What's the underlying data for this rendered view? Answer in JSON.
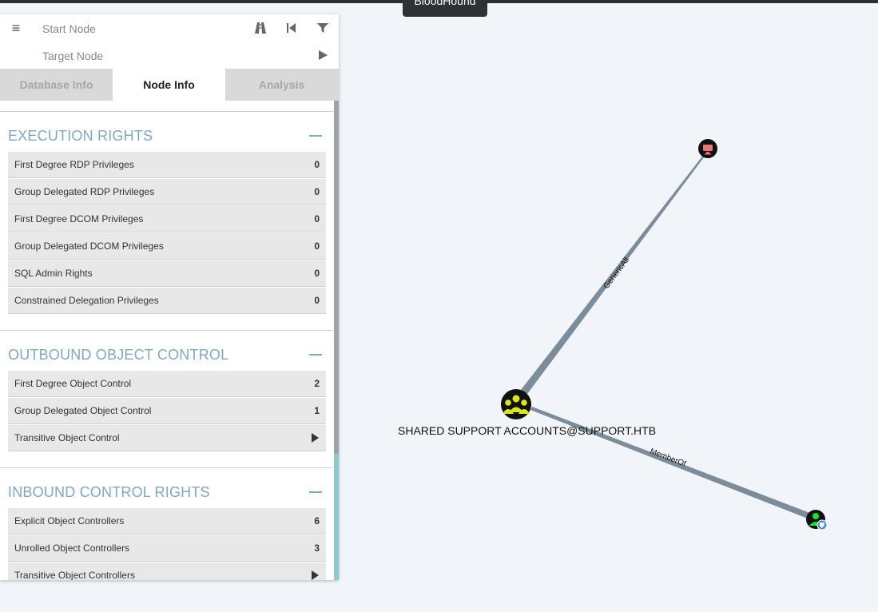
{
  "tooltip": "BloodHound",
  "search": {
    "start_placeholder": "Start Node",
    "target_placeholder": "Target Node"
  },
  "tabs": [
    {
      "label": "Database Info",
      "active": false
    },
    {
      "label": "Node Info",
      "active": true
    },
    {
      "label": "Analysis",
      "active": false
    }
  ],
  "sections": {
    "execution": {
      "title": "EXECUTION RIGHTS",
      "rows": [
        {
          "label": "First Degree RDP Privileges",
          "value": "0"
        },
        {
          "label": "Group Delegated RDP Privileges",
          "value": "0"
        },
        {
          "label": "First Degree DCOM Privileges",
          "value": "0"
        },
        {
          "label": "Group Delegated DCOM Privileges",
          "value": "0"
        },
        {
          "label": "SQL Admin Rights",
          "value": "0"
        },
        {
          "label": "Constrained Delegation Privileges",
          "value": "0"
        }
      ]
    },
    "outbound": {
      "title": "OUTBOUND OBJECT CONTROL",
      "rows": [
        {
          "label": "First Degree Object Control",
          "value": "2"
        },
        {
          "label": "Group Delegated Object Control",
          "value": "1"
        },
        {
          "label": "Transitive Object Control",
          "value": ""
        }
      ]
    },
    "inbound": {
      "title": "INBOUND CONTROL RIGHTS",
      "rows": [
        {
          "label": "Explicit Object Controllers",
          "value": "6"
        },
        {
          "label": "Unrolled Object Controllers",
          "value": "3"
        },
        {
          "label": "Transitive Object Controllers",
          "value": ""
        }
      ]
    }
  },
  "graph": {
    "group_node_label": "SHARED SUPPORT ACCOUNTS@SUPPORT.HTB",
    "edge_generic_all": "GenericAll",
    "edge_member_of": "MemberOf"
  },
  "colors": {
    "section_title": "#7fa9be",
    "group_node": "#dbe617",
    "computer_node": "#e67873",
    "user_node": "#17e625",
    "edge": "#7b8d9a"
  },
  "icons": [
    "menu-icon",
    "pathfinding-icon",
    "back-icon",
    "filter-icon",
    "play-icon",
    "group-icon",
    "computer-icon",
    "user-icon",
    "shield-icon"
  ]
}
